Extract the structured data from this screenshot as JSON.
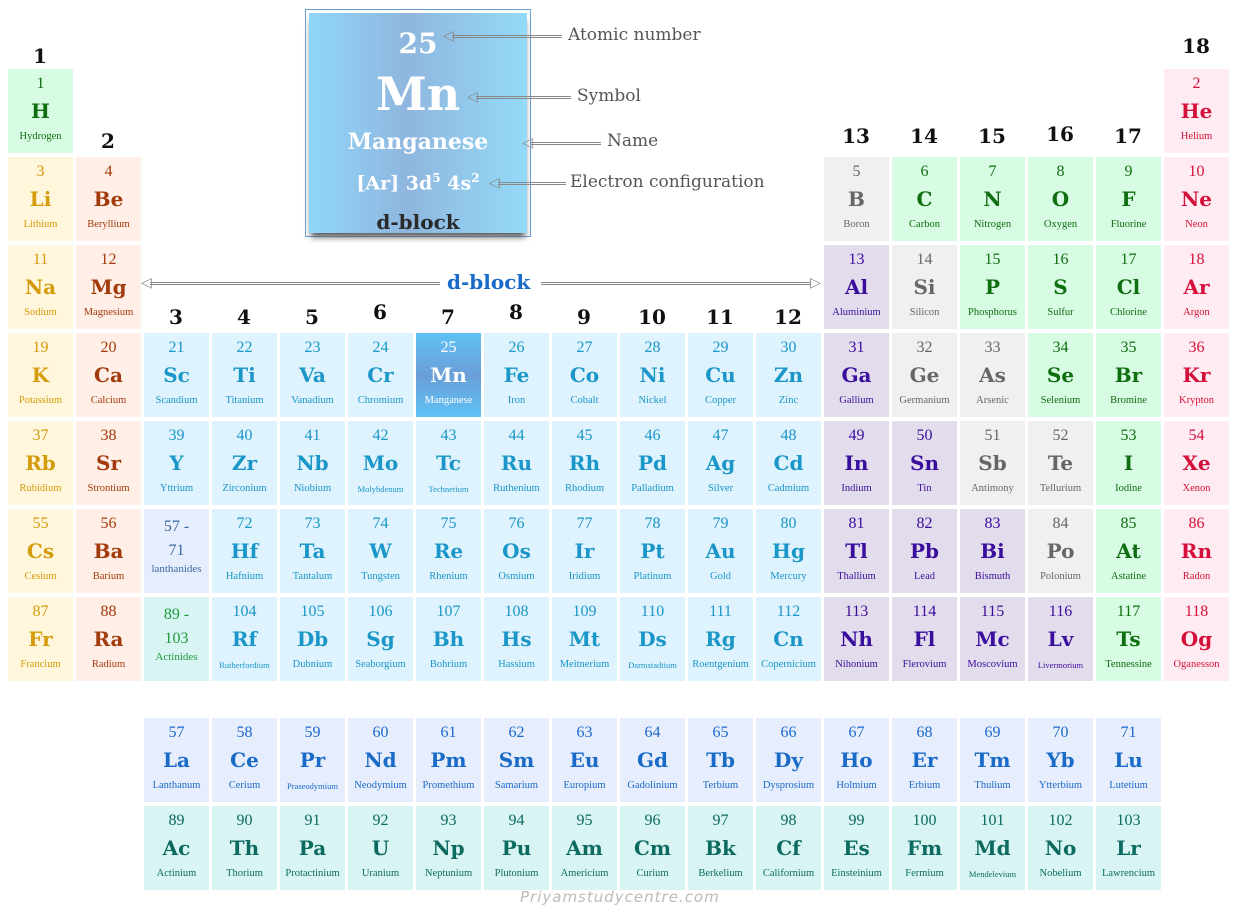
{
  "legend": {
    "atomic_number": "25",
    "symbol": "Mn",
    "name": "Manganese",
    "config_prefix": "[Ar] 3d",
    "config_sup1": "5",
    "config_mid": " 4s",
    "config_sup2": "2",
    "block": "d-block",
    "annotations": {
      "atomic_number": "Atomic number",
      "symbol": "Symbol",
      "name": "Name",
      "electron_configuration": "Electron configuration"
    }
  },
  "dblock_label": "d-block",
  "watermark": "Priyamstudycentre.com",
  "highlight_element": 25,
  "colors": {
    "alkali": "#d49b0a",
    "alkaline_earth": "#a23a0c",
    "transition": "#1a96c8",
    "post_transition": "#3a0e9c",
    "metalloid": "#666666",
    "nonmetal": "#0f6e0f",
    "noble_gas": "#d4103a",
    "lanthanide": "#1a6ac8",
    "actinide": "#0c6a60",
    "dblock_accent": "#1a6ac8"
  },
  "groups": [
    "1",
    "2",
    "3",
    "4",
    "5",
    "6",
    "7",
    "8",
    "9",
    "10",
    "11",
    "12",
    "13",
    "14",
    "15",
    "16",
    "17",
    "18"
  ],
  "elements": [
    {
      "n": "1",
      "s": "H",
      "name": "Hydrogen",
      "cat": "nonmetal",
      "col": 1,
      "row": 1
    },
    {
      "n": "2",
      "s": "He",
      "name": "Helium",
      "cat": "noble",
      "col": 18,
      "row": 1
    },
    {
      "n": "3",
      "s": "Li",
      "name": "Lithium",
      "cat": "alkali",
      "col": 1,
      "row": 2
    },
    {
      "n": "4",
      "s": "Be",
      "name": "Beryllium",
      "cat": "alkaline",
      "col": 2,
      "row": 2
    },
    {
      "n": "5",
      "s": "B",
      "name": "Boron",
      "cat": "metalloid",
      "col": 13,
      "row": 2
    },
    {
      "n": "6",
      "s": "C",
      "name": "Carbon",
      "cat": "nonmetal",
      "col": 14,
      "row": 2
    },
    {
      "n": "7",
      "s": "N",
      "name": "Nitrogen",
      "cat": "nonmetal",
      "col": 15,
      "row": 2
    },
    {
      "n": "8",
      "s": "O",
      "name": "Oxygen",
      "cat": "nonmetal",
      "col": 16,
      "row": 2
    },
    {
      "n": "9",
      "s": "F",
      "name": "Fluorine",
      "cat": "nonmetal",
      "col": 17,
      "row": 2
    },
    {
      "n": "10",
      "s": "Ne",
      "name": "Neon",
      "cat": "noble",
      "col": 18,
      "row": 2
    },
    {
      "n": "11",
      "s": "Na",
      "name": "Sodium",
      "cat": "alkali",
      "col": 1,
      "row": 3
    },
    {
      "n": "12",
      "s": "Mg",
      "name": "Magnesium",
      "cat": "alkaline",
      "col": 2,
      "row": 3
    },
    {
      "n": "13",
      "s": "Al",
      "name": "Aluminium",
      "cat": "post",
      "col": 13,
      "row": 3
    },
    {
      "n": "14",
      "s": "Si",
      "name": "Silicon",
      "cat": "metalloid",
      "col": 14,
      "row": 3
    },
    {
      "n": "15",
      "s": "P",
      "name": "Phosphorus",
      "cat": "nonmetal",
      "col": 15,
      "row": 3
    },
    {
      "n": "16",
      "s": "S",
      "name": "Sulfur",
      "cat": "nonmetal",
      "col": 16,
      "row": 3
    },
    {
      "n": "17",
      "s": "Cl",
      "name": "Chlorine",
      "cat": "nonmetal",
      "col": 17,
      "row": 3
    },
    {
      "n": "18",
      "s": "Ar",
      "name": "Argon",
      "cat": "noble",
      "col": 18,
      "row": 3
    },
    {
      "n": "19",
      "s": "K",
      "name": "Potassium",
      "cat": "alkali",
      "col": 1,
      "row": 4
    },
    {
      "n": "20",
      "s": "Ca",
      "name": "Calcium",
      "cat": "alkaline",
      "col": 2,
      "row": 4
    },
    {
      "n": "21",
      "s": "Sc",
      "name": "Scandium",
      "cat": "trans",
      "col": 3,
      "row": 4
    },
    {
      "n": "22",
      "s": "Ti",
      "name": "Titanium",
      "cat": "trans",
      "col": 4,
      "row": 4
    },
    {
      "n": "23",
      "s": "Va",
      "name": "Vanadium",
      "cat": "trans",
      "col": 5,
      "row": 4
    },
    {
      "n": "24",
      "s": "Cr",
      "name": "Chromium",
      "cat": "trans",
      "col": 6,
      "row": 4
    },
    {
      "n": "25",
      "s": "Mn",
      "name": "Manganese",
      "cat": "hl",
      "col": 7,
      "row": 4
    },
    {
      "n": "26",
      "s": "Fe",
      "name": "Iron",
      "cat": "trans",
      "col": 8,
      "row": 4
    },
    {
      "n": "27",
      "s": "Co",
      "name": "Cobalt",
      "cat": "trans",
      "col": 9,
      "row": 4
    },
    {
      "n": "28",
      "s": "Ni",
      "name": "Nickel",
      "cat": "trans",
      "col": 10,
      "row": 4
    },
    {
      "n": "29",
      "s": "Cu",
      "name": "Copper",
      "cat": "trans",
      "col": 11,
      "row": 4
    },
    {
      "n": "30",
      "s": "Zn",
      "name": "Zinc",
      "cat": "trans",
      "col": 12,
      "row": 4
    },
    {
      "n": "31",
      "s": "Ga",
      "name": "Gallium",
      "cat": "post",
      "col": 13,
      "row": 4
    },
    {
      "n": "32",
      "s": "Ge",
      "name": "Germanium",
      "cat": "metalloid",
      "col": 14,
      "row": 4
    },
    {
      "n": "33",
      "s": "As",
      "name": "Arsenic",
      "cat": "metalloid",
      "col": 15,
      "row": 4
    },
    {
      "n": "34",
      "s": "Se",
      "name": "Selenium",
      "cat": "nonmetal",
      "col": 16,
      "row": 4
    },
    {
      "n": "35",
      "s": "Br",
      "name": "Bromine",
      "cat": "nonmetal",
      "col": 17,
      "row": 4
    },
    {
      "n": "36",
      "s": "Kr",
      "name": "Krypton",
      "cat": "noble",
      "col": 18,
      "row": 4
    },
    {
      "n": "37",
      "s": "Rb",
      "name": "Rubidium",
      "cat": "alkali",
      "col": 1,
      "row": 5
    },
    {
      "n": "38",
      "s": "Sr",
      "name": "Strontium",
      "cat": "alkaline",
      "col": 2,
      "row": 5
    },
    {
      "n": "39",
      "s": "Y",
      "name": "Yttrium",
      "cat": "trans",
      "col": 3,
      "row": 5
    },
    {
      "n": "40",
      "s": "Zr",
      "name": "Zirconium",
      "cat": "trans",
      "col": 4,
      "row": 5
    },
    {
      "n": "41",
      "s": "Nb",
      "name": "Niobium",
      "cat": "trans",
      "col": 5,
      "row": 5
    },
    {
      "n": "42",
      "s": "Mo",
      "name": "Molybdenum",
      "cat": "trans",
      "col": 6,
      "row": 5,
      "small": true
    },
    {
      "n": "43",
      "s": "Tc",
      "name": "Technetium",
      "cat": "trans",
      "col": 7,
      "row": 5,
      "small": true
    },
    {
      "n": "44",
      "s": "Ru",
      "name": "Ruthenium",
      "cat": "trans",
      "col": 8,
      "row": 5
    },
    {
      "n": "45",
      "s": "Rh",
      "name": "Rhodium",
      "cat": "trans",
      "col": 9,
      "row": 5
    },
    {
      "n": "46",
      "s": "Pd",
      "name": "Palladium",
      "cat": "trans",
      "col": 10,
      "row": 5
    },
    {
      "n": "47",
      "s": "Ag",
      "name": "Silver",
      "cat": "trans",
      "col": 11,
      "row": 5
    },
    {
      "n": "48",
      "s": "Cd",
      "name": "Cadmium",
      "cat": "trans",
      "col": 12,
      "row": 5
    },
    {
      "n": "49",
      "s": "In",
      "name": "Indium",
      "cat": "post",
      "col": 13,
      "row": 5
    },
    {
      "n": "50",
      "s": "Sn",
      "name": "Tin",
      "cat": "post",
      "col": 14,
      "row": 5
    },
    {
      "n": "51",
      "s": "Sb",
      "name": "Antimony",
      "cat": "metalloid",
      "col": 15,
      "row": 5
    },
    {
      "n": "52",
      "s": "Te",
      "name": "Tellurium",
      "cat": "metalloid",
      "col": 16,
      "row": 5
    },
    {
      "n": "53",
      "s": "I",
      "name": "Iodine",
      "cat": "nonmetal",
      "col": 17,
      "row": 5
    },
    {
      "n": "54",
      "s": "Xe",
      "name": "Xenon",
      "cat": "noble",
      "col": 18,
      "row": 5
    },
    {
      "n": "55",
      "s": "Cs",
      "name": "Cesium",
      "cat": "alkali",
      "col": 1,
      "row": 6
    },
    {
      "n": "56",
      "s": "Ba",
      "name": "Barium",
      "cat": "alkaline",
      "col": 2,
      "row": 6
    },
    {
      "n": "72",
      "s": "Hf",
      "name": "Hafnium",
      "cat": "trans",
      "col": 4,
      "row": 6
    },
    {
      "n": "73",
      "s": "Ta",
      "name": "Tantalum",
      "cat": "trans",
      "col": 5,
      "row": 6
    },
    {
      "n": "74",
      "s": "W",
      "name": "Tungsten",
      "cat": "trans",
      "col": 6,
      "row": 6
    },
    {
      "n": "75",
      "s": "Re",
      "name": "Rhenium",
      "cat": "trans",
      "col": 7,
      "row": 6
    },
    {
      "n": "76",
      "s": "Os",
      "name": "Osmium",
      "cat": "trans",
      "col": 8,
      "row": 6
    },
    {
      "n": "77",
      "s": "Ir",
      "name": "Iridium",
      "cat": "trans",
      "col": 9,
      "row": 6
    },
    {
      "n": "78",
      "s": "Pt",
      "name": "Platinum",
      "cat": "trans",
      "col": 10,
      "row": 6
    },
    {
      "n": "79",
      "s": "Au",
      "name": "Gold",
      "cat": "trans",
      "col": 11,
      "row": 6
    },
    {
      "n": "80",
      "s": "Hg",
      "name": "Mercury",
      "cat": "trans",
      "col": 12,
      "row": 6
    },
    {
      "n": "81",
      "s": "Tl",
      "name": "Thallium",
      "cat": "post",
      "col": 13,
      "row": 6
    },
    {
      "n": "82",
      "s": "Pb",
      "name": "Lead",
      "cat": "post",
      "col": 14,
      "row": 6
    },
    {
      "n": "83",
      "s": "Bi",
      "name": "Bismuth",
      "cat": "post",
      "col": 15,
      "row": 6
    },
    {
      "n": "84",
      "s": "Po",
      "name": "Polonium",
      "cat": "metalloid",
      "col": 16,
      "row": 6
    },
    {
      "n": "85",
      "s": "At",
      "name": "Astatine",
      "cat": "nonmetal",
      "col": 17,
      "row": 6
    },
    {
      "n": "86",
      "s": "Rn",
      "name": "Radon",
      "cat": "noble",
      "col": 18,
      "row": 6
    },
    {
      "n": "87",
      "s": "Fr",
      "name": "Francium",
      "cat": "alkali",
      "col": 1,
      "row": 7
    },
    {
      "n": "88",
      "s": "Ra",
      "name": "Radium",
      "cat": "alkaline",
      "col": 2,
      "row": 7
    },
    {
      "n": "104",
      "s": "Rf",
      "name": "Rutherfordium",
      "cat": "trans",
      "col": 4,
      "row": 7,
      "small": true
    },
    {
      "n": "105",
      "s": "Db",
      "name": "Dubnium",
      "cat": "trans",
      "col": 5,
      "row": 7
    },
    {
      "n": "106",
      "s": "Sg",
      "name": "Seaborgium",
      "cat": "trans",
      "col": 6,
      "row": 7
    },
    {
      "n": "107",
      "s": "Bh",
      "name": "Bohrium",
      "cat": "trans",
      "col": 7,
      "row": 7
    },
    {
      "n": "108",
      "s": "Hs",
      "name": "Hassium",
      "cat": "trans",
      "col": 8,
      "row": 7
    },
    {
      "n": "109",
      "s": "Mt",
      "name": "Meitnerium",
      "cat": "trans",
      "col": 9,
      "row": 7
    },
    {
      "n": "110",
      "s": "Ds",
      "name": "Darmstadtium",
      "cat": "trans",
      "col": 10,
      "row": 7,
      "small": true
    },
    {
      "n": "111",
      "s": "Rg",
      "name": "Roentgenium",
      "cat": "trans",
      "col": 11,
      "row": 7
    },
    {
      "n": "112",
      "s": "Cn",
      "name": "Copernicium",
      "cat": "trans",
      "col": 12,
      "row": 7
    },
    {
      "n": "113",
      "s": "Nh",
      "name": "Nihonium",
      "cat": "post",
      "col": 13,
      "row": 7
    },
    {
      "n": "114",
      "s": "Fl",
      "name": "Flerovium",
      "cat": "post",
      "col": 14,
      "row": 7
    },
    {
      "n": "115",
      "s": "Mc",
      "name": "Moscovium",
      "cat": "post",
      "col": 15,
      "row": 7
    },
    {
      "n": "116",
      "s": "Lv",
      "name": "Livermorium",
      "cat": "post",
      "col": 16,
      "row": 7,
      "small": true
    },
    {
      "n": "117",
      "s": "Ts",
      "name": "Tennessine",
      "cat": "nonmetal",
      "col": 17,
      "row": 7
    },
    {
      "n": "118",
      "s": "Og",
      "name": "Oganesson",
      "cat": "noble",
      "col": 18,
      "row": 7
    }
  ],
  "series_refs": [
    {
      "range1": "57 -",
      "range2": "71",
      "label": "lanthanides",
      "cat": "lanthref",
      "col": 3,
      "row": 6
    },
    {
      "range1": "89 -",
      "range2": "103",
      "label": "Actinides",
      "cat": "actinref",
      "col": 3,
      "row": 7
    }
  ],
  "lanthanides": [
    {
      "n": "57",
      "s": "La",
      "name": "Lanthanum"
    },
    {
      "n": "58",
      "s": "Ce",
      "name": "Cerium"
    },
    {
      "n": "59",
      "s": "Pr",
      "name": "Praseodymium",
      "small": true
    },
    {
      "n": "60",
      "s": "Nd",
      "name": "Neodymium"
    },
    {
      "n": "61",
      "s": "Pm",
      "name": "Promethium"
    },
    {
      "n": "62",
      "s": "Sm",
      "name": "Samarium"
    },
    {
      "n": "63",
      "s": "Eu",
      "name": "Europium"
    },
    {
      "n": "64",
      "s": "Gd",
      "name": "Gadolinium"
    },
    {
      "n": "65",
      "s": "Tb",
      "name": "Terbium"
    },
    {
      "n": "66",
      "s": "Dy",
      "name": "Dysprosium"
    },
    {
      "n": "67",
      "s": "Ho",
      "name": "Holmium"
    },
    {
      "n": "68",
      "s": "Er",
      "name": "Erbium"
    },
    {
      "n": "69",
      "s": "Tm",
      "name": "Thulium"
    },
    {
      "n": "70",
      "s": "Yb",
      "name": "Ytterbium"
    },
    {
      "n": "71",
      "s": "Lu",
      "name": "Lutetium"
    }
  ],
  "actinides": [
    {
      "n": "89",
      "s": "Ac",
      "name": "Actinium"
    },
    {
      "n": "90",
      "s": "Th",
      "name": "Thorium"
    },
    {
      "n": "91",
      "s": "Pa",
      "name": "Protactinium"
    },
    {
      "n": "92",
      "s": "U",
      "name": "Uranium"
    },
    {
      "n": "93",
      "s": "Np",
      "name": "Neptunium"
    },
    {
      "n": "94",
      "s": "Pu",
      "name": "Plutonium"
    },
    {
      "n": "95",
      "s": "Am",
      "name": "Americium"
    },
    {
      "n": "96",
      "s": "Cm",
      "name": "Curium"
    },
    {
      "n": "97",
      "s": "Bk",
      "name": "Berkelium"
    },
    {
      "n": "98",
      "s": "Cf",
      "name": "Californium"
    },
    {
      "n": "99",
      "s": "Es",
      "name": "Einsteinium"
    },
    {
      "n": "100",
      "s": "Fm",
      "name": "Fermium"
    },
    {
      "n": "101",
      "s": "Md",
      "name": "Mendelevium",
      "small": true
    },
    {
      "n": "102",
      "s": "No",
      "name": "Nobelium"
    },
    {
      "n": "103",
      "s": "Lr",
      "name": "Lawrencium"
    }
  ]
}
